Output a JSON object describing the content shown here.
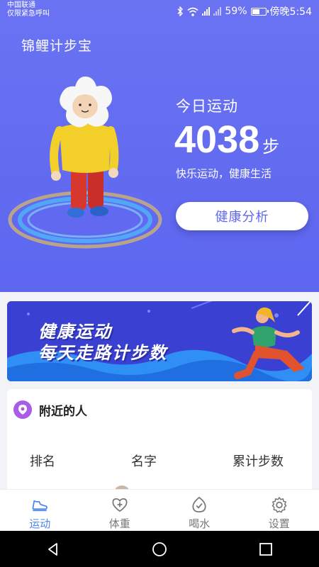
{
  "status_bar": {
    "carrier_line1": "中国联通",
    "carrier_line2": "仅限紧急呼叫",
    "battery_percent": "59%",
    "battery_level": 0.59,
    "time": "傍晚5:54"
  },
  "app": {
    "title": "锦鲤计步宝"
  },
  "today": {
    "label": "今日运动",
    "steps": "4038",
    "unit": "步",
    "slogan": "快乐运动，健康生活",
    "analysis_button": "健康分析"
  },
  "banner": {
    "line1": "健康运动",
    "line2": "每天走路计步数"
  },
  "nearby": {
    "title": "附近的人",
    "columns": [
      "排名",
      "名字",
      "累计步数"
    ]
  },
  "tabs": [
    {
      "label": "运动",
      "icon": "shoe-icon",
      "active": true
    },
    {
      "label": "体重",
      "icon": "heart-plus-icon",
      "active": false
    },
    {
      "label": "喝水",
      "icon": "drop-check-icon",
      "active": false
    },
    {
      "label": "设置",
      "icon": "gear-icon",
      "active": false
    }
  ],
  "colors": {
    "hero_bg": "#6a73f2",
    "accent": "#5e67ef",
    "tab_active": "#4a86f0",
    "pin": "#a95ce8"
  }
}
